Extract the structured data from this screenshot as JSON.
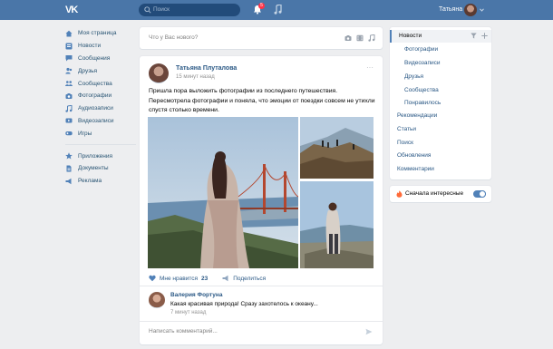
{
  "header": {
    "logo_text": "VK",
    "search_placeholder": "Поиск",
    "notifications_count": "5",
    "user_name": "Татьяна"
  },
  "nav": {
    "items": [
      {
        "label": "Моя страница",
        "icon": "home-icon"
      },
      {
        "label": "Новости",
        "icon": "news-icon"
      },
      {
        "label": "Сообщения",
        "icon": "messages-icon"
      },
      {
        "label": "Друзья",
        "icon": "friends-icon"
      },
      {
        "label": "Сообщества",
        "icon": "communities-icon"
      },
      {
        "label": "Фотографии",
        "icon": "camera-icon"
      },
      {
        "label": "Аудиозаписи",
        "icon": "music-icon"
      },
      {
        "label": "Видеозаписи",
        "icon": "video-icon"
      },
      {
        "label": "Игры",
        "icon": "games-icon"
      }
    ],
    "items2": [
      {
        "label": "Приложения",
        "icon": "apps-icon"
      },
      {
        "label": "Документы",
        "icon": "documents-icon"
      },
      {
        "label": "Реклама",
        "icon": "ads-icon"
      }
    ]
  },
  "composer": {
    "placeholder": "Что у Вас нового?"
  },
  "post": {
    "author": "Татьяна Плуталова",
    "time": "15 минут назад",
    "text": "Пришла пора выложить фотографии из последнего путешествия. Пересмотрела фотографии и поняла, что эмоции от поездки совсем не утихли спустя столько времени.",
    "like_label": "Мне нравится",
    "like_count": "23",
    "share_label": "Поделиться"
  },
  "comment": {
    "author": "Валерия Фортуна",
    "text": "Какая красивая природа! Сразу захотелось к океану...",
    "time": "7 минут назад",
    "input_placeholder": "Написать комментарий..."
  },
  "right_menu": {
    "active": "Новости",
    "sub_items": [
      "Фотографии",
      "Видеозаписи",
      "Друзья",
      "Сообщества",
      "Понравилось"
    ],
    "items": [
      "Рекомендации",
      "Статьи",
      "Поиск",
      "Обновления",
      "Комментарии"
    ]
  },
  "interesting_first": {
    "label": "Сначала интересные",
    "enabled": true
  },
  "colors": {
    "header": "#4a76a8",
    "link": "#2a5885",
    "background": "#edeef0"
  }
}
